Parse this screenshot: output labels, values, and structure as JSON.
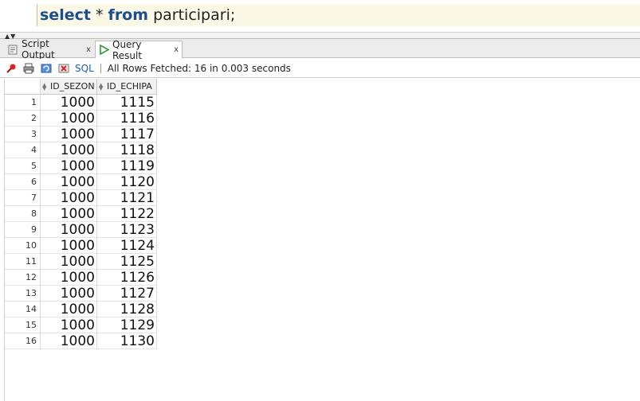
{
  "editor": {
    "sql_keyword1": "select",
    "sql_star": " * ",
    "sql_keyword2": "from",
    "sql_rest": " participari;"
  },
  "tabs": [
    {
      "label": "Script Output",
      "icon": "script-output-icon",
      "close": "x"
    },
    {
      "label": "Query Result",
      "icon": "run-arrow-icon",
      "close": "x"
    }
  ],
  "toolbar": {
    "sql_label": "SQL",
    "status": "All Rows Fetched: 16 in 0.003 seconds"
  },
  "grid": {
    "columns": [
      "ID_SEZON",
      "ID_ECHIPA"
    ],
    "rows": [
      {
        "n": "1",
        "id_sezon": "1000",
        "id_echipa": "1115"
      },
      {
        "n": "2",
        "id_sezon": "1000",
        "id_echipa": "1116"
      },
      {
        "n": "3",
        "id_sezon": "1000",
        "id_echipa": "1117"
      },
      {
        "n": "4",
        "id_sezon": "1000",
        "id_echipa": "1118"
      },
      {
        "n": "5",
        "id_sezon": "1000",
        "id_echipa": "1119"
      },
      {
        "n": "6",
        "id_sezon": "1000",
        "id_echipa": "1120"
      },
      {
        "n": "7",
        "id_sezon": "1000",
        "id_echipa": "1121"
      },
      {
        "n": "8",
        "id_sezon": "1000",
        "id_echipa": "1122"
      },
      {
        "n": "9",
        "id_sezon": "1000",
        "id_echipa": "1123"
      },
      {
        "n": "10",
        "id_sezon": "1000",
        "id_echipa": "1124"
      },
      {
        "n": "11",
        "id_sezon": "1000",
        "id_echipa": "1125"
      },
      {
        "n": "12",
        "id_sezon": "1000",
        "id_echipa": "1126"
      },
      {
        "n": "13",
        "id_sezon": "1000",
        "id_echipa": "1127"
      },
      {
        "n": "14",
        "id_sezon": "1000",
        "id_echipa": "1128"
      },
      {
        "n": "15",
        "id_sezon": "1000",
        "id_echipa": "1129"
      },
      {
        "n": "16",
        "id_sezon": "1000",
        "id_echipa": "1130"
      }
    ]
  },
  "colors": {
    "keyword": "#1a4e8c",
    "editor_line_bg": "#fcf8e6",
    "run_arrow": "#2e9b3a"
  }
}
